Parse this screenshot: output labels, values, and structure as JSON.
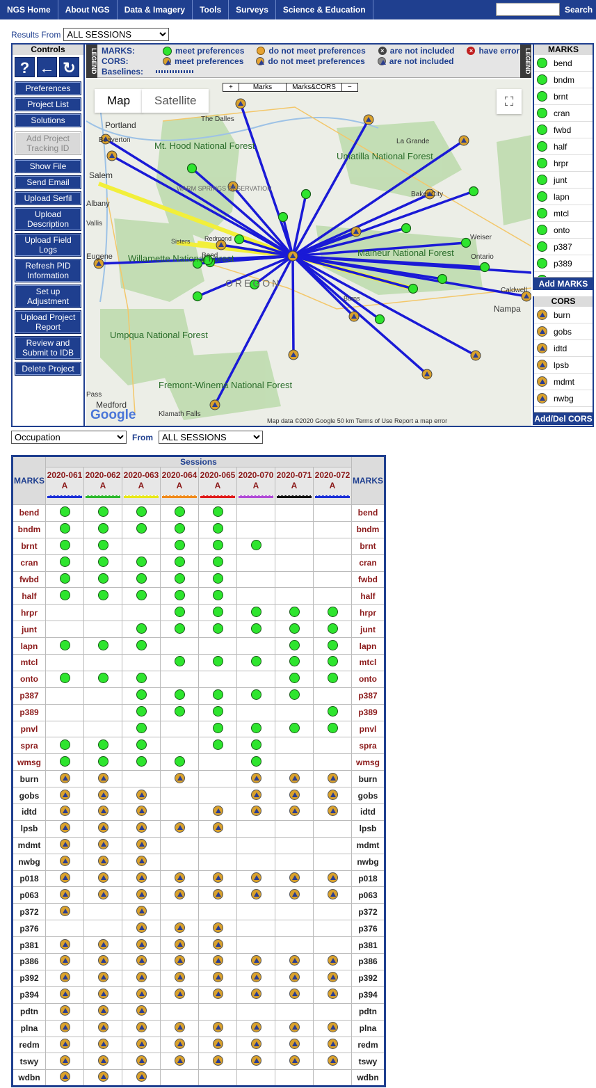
{
  "nav": {
    "items": [
      "NGS Home",
      "About NGS",
      "Data & Imagery",
      "Tools",
      "Surveys",
      "Science & Education"
    ],
    "search_label": "Search"
  },
  "results": {
    "label": "Results From",
    "selected": "ALL SESSIONS"
  },
  "controls": {
    "title": "Controls",
    "icons": [
      "help-icon",
      "back-arrow-icon",
      "refresh-icon"
    ],
    "icon_glyphs": [
      "?",
      "←",
      "↻"
    ],
    "buttons": [
      {
        "label": "Preferences"
      },
      {
        "label": "Project List"
      },
      {
        "label": "Solutions"
      },
      {
        "label": "Add Project Tracking ID",
        "disabled": true
      },
      {
        "label": "Show File"
      },
      {
        "label": "Send Email"
      },
      {
        "label": "Upload Serfil"
      },
      {
        "label": "Upload Description"
      },
      {
        "label": "Upload Field Logs"
      },
      {
        "label": "Refresh PID Information"
      },
      {
        "label": "Set up Adjustment"
      },
      {
        "label": "Upload Project Report"
      },
      {
        "label": "Review and Submit to IDB"
      },
      {
        "label": "Delete Project"
      }
    ]
  },
  "legend": {
    "tab_label": "LEGEND",
    "marks_label": "MARKS:",
    "cors_label": "CORS:",
    "baselines_label": "Baselines:",
    "marks_meet": "meet preferences",
    "marks_not_meet": "do not meet preferences",
    "marks_not_included": "are not included",
    "marks_error": "have error",
    "cors_meet": "meet preferences",
    "cors_not_meet": "do not meet preferences",
    "cors_not_included": "are not included"
  },
  "map": {
    "tab_map": "Map",
    "tab_satellite": "Satellite",
    "zoom_plus": "+",
    "zoom_marks": "Marks",
    "zoom_marks_cors": "Marks&CORS",
    "zoom_minus": "−",
    "footer": "Map data ©2020 Google   50 km   Terms of Use   Report a map error",
    "google": "Google",
    "labels": [
      "Portland",
      "Beaverton",
      "Salem",
      "Albany",
      "Eugene",
      "The Dalles",
      "Mt. Hood National Forest",
      "Umatilla National Forest",
      "La Grande",
      "Baker City",
      "Weiser",
      "Malheur National Forest",
      "Ontario",
      "Nampa",
      "Caldwell",
      "Willamette National Forest",
      "OREGON",
      "Umpqua National Forest",
      "Fremont-Winema National Forest",
      "Medford",
      "Klamath Falls",
      "Redmond",
      "Bend",
      "Sisters",
      "Burns",
      "WARM SPRINGS RESERVATION",
      "Vallis",
      "Pass"
    ]
  },
  "marks_panel": {
    "title": "MARKS",
    "items": [
      "bend",
      "bndm",
      "brnt",
      "cran",
      "fwbd",
      "half",
      "hrpr",
      "junt",
      "lapn",
      "mtcl",
      "onto",
      "p387",
      "p389",
      "pnvl"
    ],
    "button": "Add MARKS"
  },
  "cors_panel": {
    "title": "CORS",
    "items": [
      "burn",
      "gobs",
      "idtd",
      "lpsb",
      "mdmt",
      "nwbg"
    ],
    "button": "Add/Del CORS"
  },
  "occupation": {
    "selected": "Occupation",
    "from_label": "From",
    "from_selected": "ALL SESSIONS"
  },
  "sessions": {
    "header": "Sessions",
    "marks_header": "MARKS",
    "columns": [
      {
        "id": "2020-061",
        "code": "A",
        "color": "#1a2fd6"
      },
      {
        "id": "2020-062",
        "code": "A",
        "color": "#2db82d"
      },
      {
        "id": "2020-063",
        "code": "A",
        "color": "#e8e81a"
      },
      {
        "id": "2020-064",
        "code": "A",
        "color": "#f08a1a"
      },
      {
        "id": "2020-065",
        "code": "A",
        "color": "#e01a1a"
      },
      {
        "id": "2020-070",
        "code": "A",
        "color": "#b04ad6"
      },
      {
        "id": "2020-071",
        "code": "A",
        "color": "#111111"
      },
      {
        "id": "2020-072",
        "code": "A",
        "color": "#1a2fd6"
      }
    ],
    "rows": [
      {
        "name": "bend",
        "type": "mark",
        "cells": [
          1,
          1,
          1,
          1,
          1,
          0,
          0,
          0
        ]
      },
      {
        "name": "bndm",
        "type": "mark",
        "cells": [
          1,
          1,
          1,
          1,
          1,
          0,
          0,
          0
        ]
      },
      {
        "name": "brnt",
        "type": "mark",
        "cells": [
          1,
          1,
          0,
          1,
          1,
          1,
          0,
          0
        ]
      },
      {
        "name": "cran",
        "type": "mark",
        "cells": [
          1,
          1,
          1,
          1,
          1,
          0,
          0,
          0
        ]
      },
      {
        "name": "fwbd",
        "type": "mark",
        "cells": [
          1,
          1,
          1,
          1,
          1,
          0,
          0,
          0
        ]
      },
      {
        "name": "half",
        "type": "mark",
        "cells": [
          1,
          1,
          1,
          1,
          1,
          0,
          0,
          0
        ]
      },
      {
        "name": "hrpr",
        "type": "mark",
        "cells": [
          0,
          0,
          0,
          1,
          1,
          1,
          1,
          1
        ]
      },
      {
        "name": "junt",
        "type": "mark",
        "cells": [
          0,
          0,
          1,
          1,
          1,
          1,
          1,
          1
        ]
      },
      {
        "name": "lapn",
        "type": "mark",
        "cells": [
          1,
          1,
          1,
          0,
          0,
          0,
          1,
          1
        ]
      },
      {
        "name": "mtcl",
        "type": "mark",
        "cells": [
          0,
          0,
          0,
          1,
          1,
          1,
          1,
          1
        ]
      },
      {
        "name": "onto",
        "type": "mark",
        "cells": [
          1,
          1,
          1,
          0,
          0,
          0,
          1,
          1
        ]
      },
      {
        "name": "p387",
        "type": "mark",
        "cells": [
          0,
          0,
          1,
          1,
          1,
          1,
          1,
          0
        ]
      },
      {
        "name": "p389",
        "type": "mark",
        "cells": [
          0,
          0,
          1,
          1,
          1,
          0,
          0,
          1
        ]
      },
      {
        "name": "pnvl",
        "type": "mark",
        "cells": [
          0,
          0,
          1,
          0,
          1,
          1,
          1,
          1
        ]
      },
      {
        "name": "spra",
        "type": "mark",
        "cells": [
          1,
          1,
          1,
          0,
          1,
          1,
          0,
          0
        ]
      },
      {
        "name": "wmsg",
        "type": "mark",
        "cells": [
          1,
          1,
          1,
          1,
          0,
          1,
          0,
          0
        ]
      },
      {
        "name": "burn",
        "type": "cors",
        "cells": [
          1,
          1,
          0,
          1,
          0,
          1,
          1,
          1
        ]
      },
      {
        "name": "gobs",
        "type": "cors",
        "cells": [
          1,
          1,
          1,
          0,
          0,
          1,
          1,
          1
        ]
      },
      {
        "name": "idtd",
        "type": "cors",
        "cells": [
          1,
          1,
          1,
          0,
          1,
          1,
          1,
          1
        ]
      },
      {
        "name": "lpsb",
        "type": "cors",
        "cells": [
          1,
          1,
          1,
          1,
          1,
          0,
          0,
          0
        ]
      },
      {
        "name": "mdmt",
        "type": "cors",
        "cells": [
          1,
          1,
          1,
          0,
          0,
          0,
          0,
          0
        ]
      },
      {
        "name": "nwbg",
        "type": "cors",
        "cells": [
          1,
          1,
          1,
          0,
          0,
          0,
          0,
          0
        ]
      },
      {
        "name": "p018",
        "type": "cors",
        "cells": [
          1,
          1,
          1,
          1,
          1,
          1,
          1,
          1
        ]
      },
      {
        "name": "p063",
        "type": "cors",
        "cells": [
          1,
          1,
          1,
          1,
          1,
          1,
          1,
          1
        ]
      },
      {
        "name": "p372",
        "type": "cors",
        "cells": [
          1,
          0,
          1,
          0,
          0,
          0,
          0,
          0
        ]
      },
      {
        "name": "p376",
        "type": "cors",
        "cells": [
          0,
          0,
          1,
          1,
          1,
          0,
          0,
          0
        ]
      },
      {
        "name": "p381",
        "type": "cors",
        "cells": [
          1,
          1,
          1,
          1,
          1,
          0,
          0,
          0
        ]
      },
      {
        "name": "p386",
        "type": "cors",
        "cells": [
          1,
          1,
          1,
          1,
          1,
          1,
          1,
          1
        ]
      },
      {
        "name": "p392",
        "type": "cors",
        "cells": [
          1,
          1,
          1,
          1,
          1,
          1,
          1,
          1
        ]
      },
      {
        "name": "p394",
        "type": "cors",
        "cells": [
          1,
          1,
          1,
          1,
          1,
          1,
          1,
          1
        ]
      },
      {
        "name": "pdtn",
        "type": "cors",
        "cells": [
          1,
          1,
          1,
          0,
          0,
          0,
          0,
          0
        ]
      },
      {
        "name": "plna",
        "type": "cors",
        "cells": [
          1,
          1,
          1,
          1,
          1,
          1,
          1,
          1
        ]
      },
      {
        "name": "redm",
        "type": "cors",
        "cells": [
          1,
          1,
          1,
          1,
          1,
          1,
          1,
          1
        ]
      },
      {
        "name": "tswy",
        "type": "cors",
        "cells": [
          1,
          1,
          1,
          1,
          1,
          1,
          1,
          1
        ]
      },
      {
        "name": "wdbn",
        "type": "cors",
        "cells": [
          1,
          1,
          1,
          0,
          0,
          0,
          0,
          0
        ]
      }
    ]
  }
}
